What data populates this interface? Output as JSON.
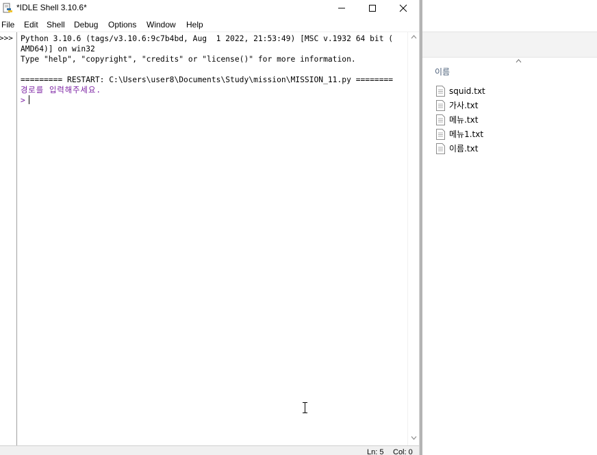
{
  "idle": {
    "window_title": "*IDLE Shell 3.10.6*",
    "menu": [
      "File",
      "Edit",
      "Shell",
      "Debug",
      "Options",
      "Window",
      "Help"
    ],
    "prompt_marker": ">>>",
    "lines": [
      "Python 3.10.6 (tags/v3.10.6:9c7b4bd, Aug  1 2022, 21:53:49) [MSC v.1932 64 bit (",
      "AMD64)] on win32",
      "Type \"help\", \"copyright\", \"credits\" or \"license()\" for more information.",
      "========= RESTART: C:\\Users\\user8\\Documents\\Study\\mission\\MISSION_11.py ========",
      "경로를 입력해주세요.",
      ">"
    ],
    "status": {
      "ln": "Ln: 5",
      "col": "Col: 0"
    }
  },
  "explorer": {
    "column_header": "이름",
    "files": [
      "squid.txt",
      "가사.txt",
      "메뉴.txt",
      "메뉴1.txt",
      "이름.txt"
    ]
  },
  "colors": {
    "stdout": "#000000",
    "stdin_prompt": "#7a1fa2"
  }
}
